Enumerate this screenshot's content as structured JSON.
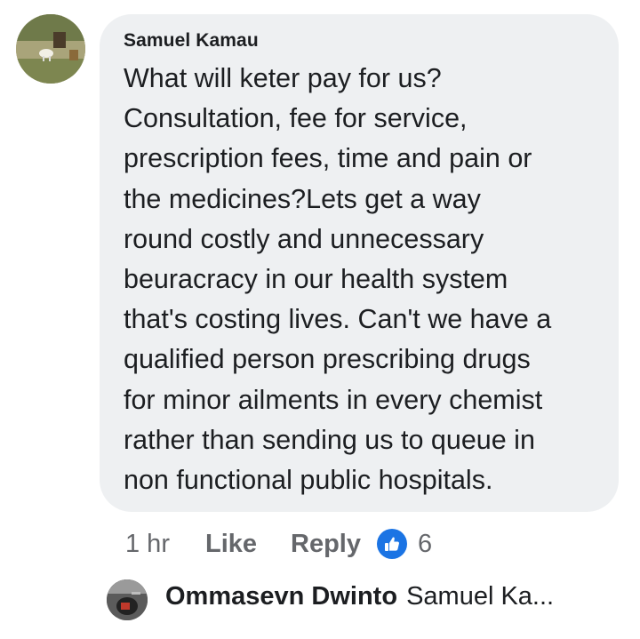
{
  "comment": {
    "author": "Samuel Kamau",
    "text_lines": [
      "What will keter pay for us?",
      "Consultation, fee for service,",
      "prescription fees, time and pain or",
      "the medicines?Lets get a way",
      "round costly and unnecessary",
      "beuracracy in our health system",
      "that's costing lives. Can't we have a",
      "qualified person prescribing drugs",
      "for minor ailments in every chemist",
      "rather than sending us to queue in",
      "non functional public hospitals."
    ],
    "time": "1 hr",
    "like_label": "Like",
    "reply_label": "Reply",
    "reaction_icon": "like-thumb-icon",
    "reaction_count": "6"
  },
  "reply": {
    "author": "Ommasevn Dwinto",
    "preview": "Samuel Ka..."
  },
  "colors": {
    "bubble_bg": "#eef0f2",
    "text": "#1c1e21",
    "muted": "#65676b",
    "like_blue": "#1b74e4"
  }
}
